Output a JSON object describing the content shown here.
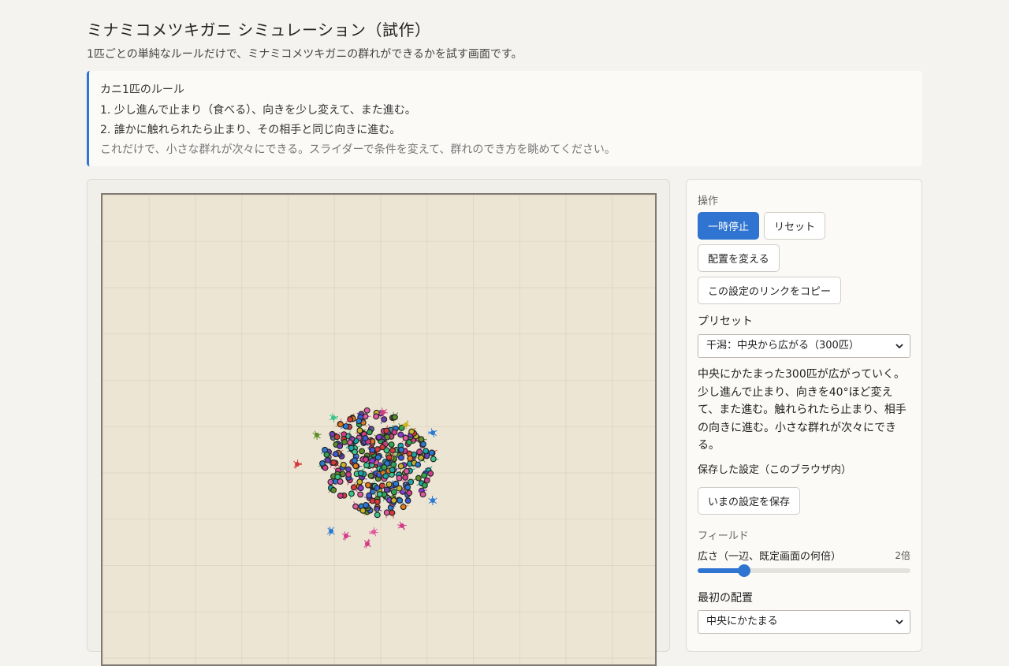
{
  "header": {
    "title": "ミナミコメツキガニ シミュレーション（試作）",
    "subtitle": "1匹ごとの単純なルールだけで、ミナミコメツキガニの群れができるかを試す画面です。"
  },
  "rules": {
    "heading": "カニ1匹のルール",
    "items": [
      "1. 少し進んで止まり（食べる）、向きを少し変えて、また進む。",
      "2. 誰かに触れられたら止まり、その相手と同じ向きに進む。"
    ],
    "note": "これだけで、小さな群れが次々にできる。スライダーで条件を変えて、群れのでき方を眺めてください。"
  },
  "colors": {
    "accent": "#2f74d0",
    "field_bg": "#ede5d3"
  },
  "controls": {
    "section_label": "操作",
    "pause_label": "一時停止",
    "reset_label": "リセット",
    "rearrange_label": "配置を変える",
    "copy_link_label": "この設定のリンクをコピー"
  },
  "preset": {
    "label": "プリセット",
    "selected": "干潟：中央から広がる（300匹）",
    "description": "中央にかたまった300匹が広がっていく。少し進んで止まり、向きを40°ほど変えて、また進む。触れられたら止まり、相手の向きに進む。小さな群れが次々にできる。"
  },
  "saved": {
    "label": "保存した設定（このブラウザ内）",
    "save_button": "いまの設定を保存"
  },
  "field_settings": {
    "section_label": "フィールド",
    "size_label": "広さ（一辺、既定画面の何倍）",
    "size_value_text": "2倍",
    "size_slider_fraction": 0.22,
    "initial_layout_label": "最初の配置",
    "initial_layout_selected": "中央にかたまる"
  }
}
